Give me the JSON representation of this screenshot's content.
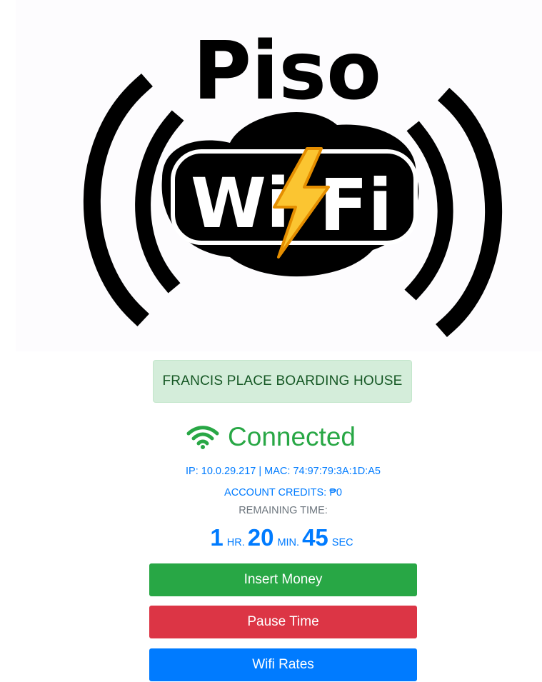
{
  "logo": {
    "title": "Piso",
    "wifi_left": "Wi",
    "wifi_right": "Fi"
  },
  "banner": {
    "text": "FRANCIS PLACE BOARDING HOUSE"
  },
  "status": {
    "icon": "wifi-icon",
    "text": "Connected",
    "color": "#28a745"
  },
  "info": {
    "ip_mac": "IP: 10.0.29.217 | MAC: 74:97:79:3A:1D:A5",
    "credits": "ACCOUNT CREDITS: ₱0",
    "remaining_label": "REMAINING TIME:"
  },
  "timer": {
    "hours": "1",
    "hours_unit": "HR.",
    "minutes": "20",
    "minutes_unit": "MIN.",
    "seconds": "45",
    "seconds_unit": "SEC"
  },
  "buttons": {
    "insert_money": "Insert Money",
    "pause_time": "Pause Time",
    "wifi_rates": "Wifi Rates"
  },
  "colors": {
    "success": "#28a745",
    "danger": "#dc3545",
    "primary": "#007bff",
    "muted": "#6c757d",
    "banner_bg": "#d4edda",
    "banner_text": "#155724"
  }
}
